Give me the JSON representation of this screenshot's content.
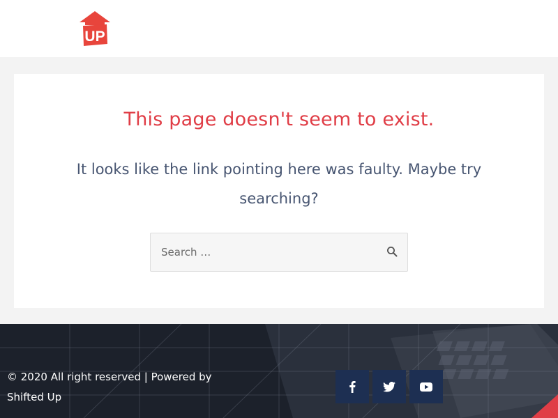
{
  "header": {
    "logo_text": "UP",
    "logo_color": "#e8453c"
  },
  "main": {
    "title": "This page doesn't seem to exist.",
    "message": "It looks like the link pointing here was faulty. Maybe try searching?",
    "search": {
      "placeholder": "Search …",
      "value": "",
      "icon": "search-icon"
    }
  },
  "footer": {
    "copyright": "© 2020 All right reserved | Powered by Shifted Up",
    "social": [
      {
        "network": "facebook",
        "icon": "facebook-icon"
      },
      {
        "network": "twitter",
        "icon": "twitter-icon"
      },
      {
        "network": "youtube",
        "icon": "youtube-icon"
      }
    ]
  },
  "colors": {
    "accent_red": "#e03d46",
    "body_text": "#475571",
    "footer_bg": "#1e2430",
    "social_bg": "#1d2f52"
  }
}
